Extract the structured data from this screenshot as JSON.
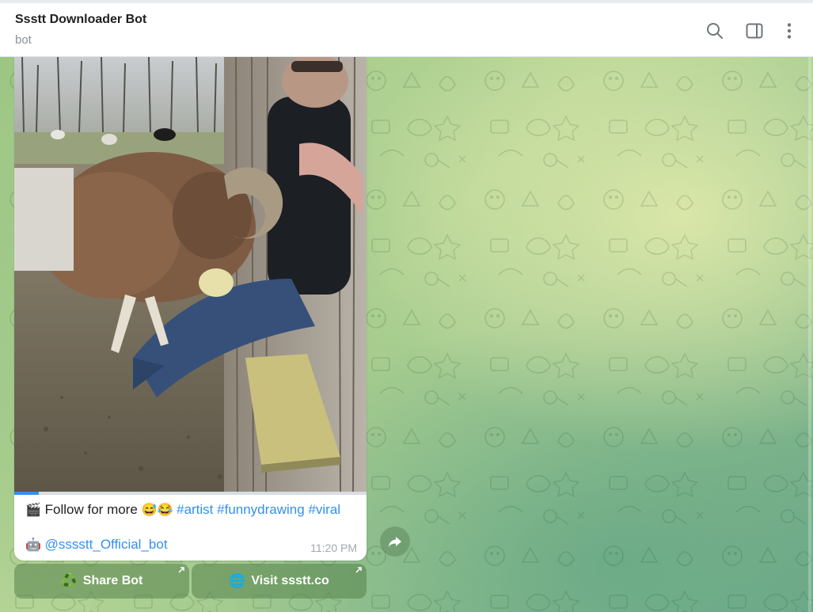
{
  "chat": {
    "title": "Ssstt Downloader Bot",
    "subtitle": "bot"
  },
  "header_icons": [
    "search-icon",
    "sidebar-toggle-icon",
    "more-vertical-icon"
  ],
  "message": {
    "caption_prefix_emoji": "🎬",
    "caption_text": "Follow for more",
    "caption_emojis": "😅😂",
    "hashtags": [
      "#artist",
      "#funnydrawing",
      "#viral"
    ],
    "mention_emoji": "🤖",
    "mention": "@sssstt_Official_bot",
    "time": "11:20 PM",
    "video_progress": 0.07
  },
  "buttons": [
    {
      "icon": "♻️",
      "label": "Share Bot"
    },
    {
      "icon": "🌐",
      "label": "Visit ssstt.co"
    }
  ],
  "colors": {
    "accent": "#3390ec",
    "header_bg": "#ffffff",
    "title_text": "#1f1f1f",
    "subtitle_text": "#8a9096"
  }
}
